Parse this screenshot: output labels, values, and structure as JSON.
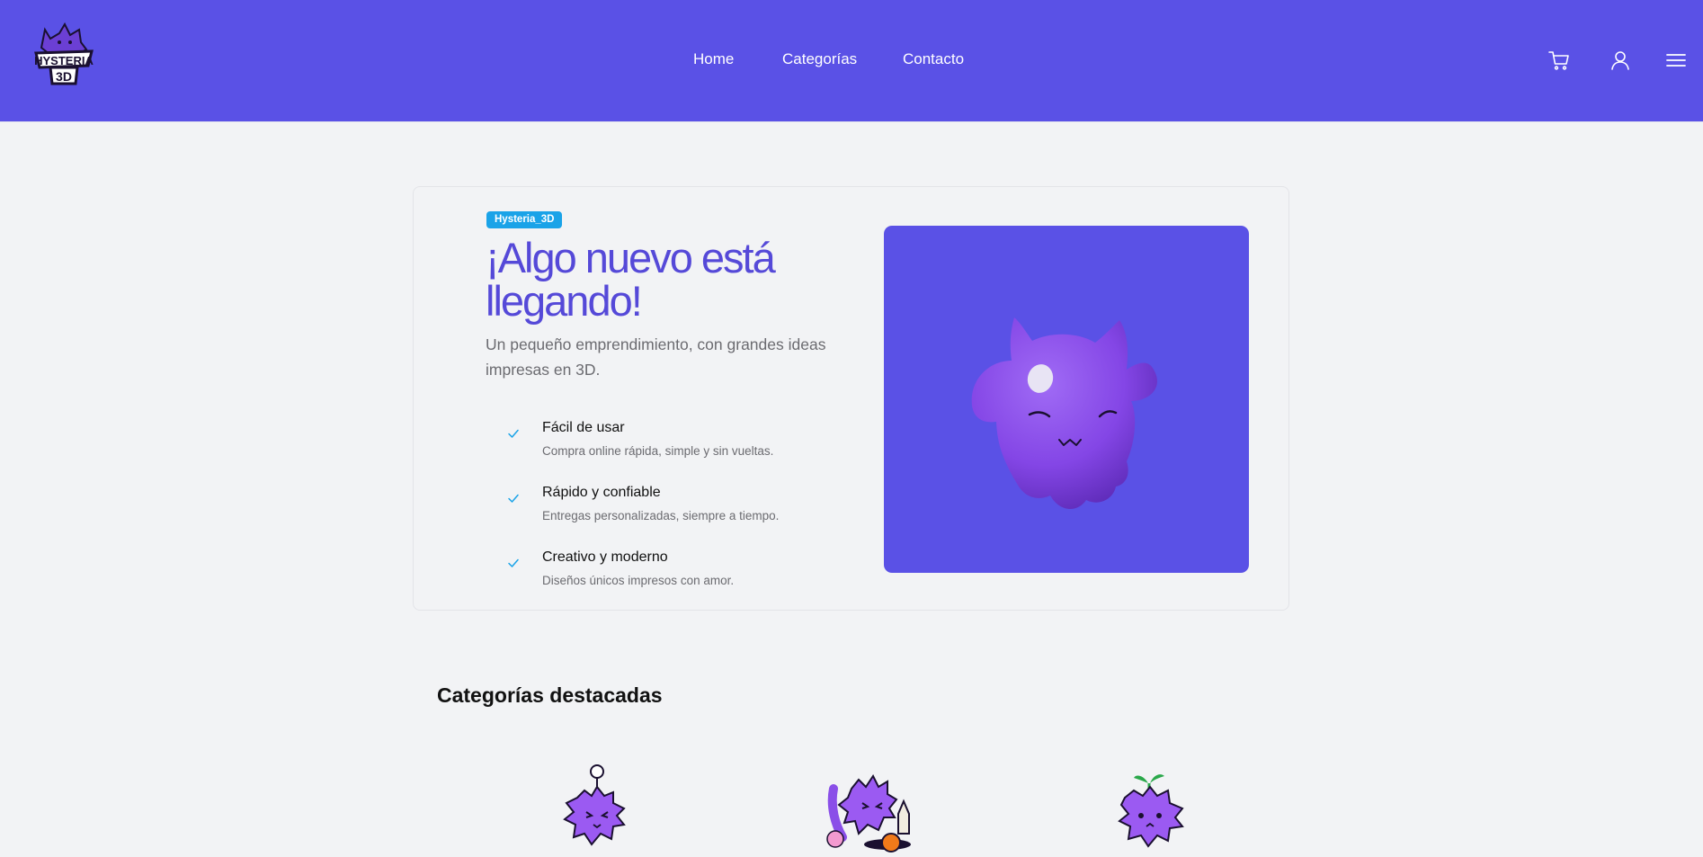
{
  "brand": {
    "logo_alt": "Hysteria 3D",
    "logo_text_top": "HYSTERIA",
    "logo_text_bottom": "3D"
  },
  "nav": [
    {
      "label": "Home"
    },
    {
      "label": "Categorías"
    },
    {
      "label": "Contacto"
    }
  ],
  "header_icons": [
    "cart-icon",
    "user-icon",
    "menu-icon"
  ],
  "hero": {
    "badge": "Hysteria_3D",
    "title": "¡Algo nuevo está llegando!",
    "subtitle": "Un pequeño emprendimiento, con grandes ideas impresas en 3D.",
    "features": [
      {
        "title": "Fácil de usar",
        "description": "Compra online rápida, simple y sin vueltas."
      },
      {
        "title": "Rápido y confiable",
        "description": "Entregas personalizadas, siempre a tiempo."
      },
      {
        "title": "Creativo y moderno",
        "description": "Diseños únicos impresos con amor."
      }
    ]
  },
  "categories": {
    "title": "Categorías destacadas"
  },
  "colors": {
    "primary": "#5a51e6",
    "title": "#5549d8",
    "badge": "#1aa3e8",
    "background": "#f2f3f5",
    "mascot": "#8a4fe8"
  }
}
